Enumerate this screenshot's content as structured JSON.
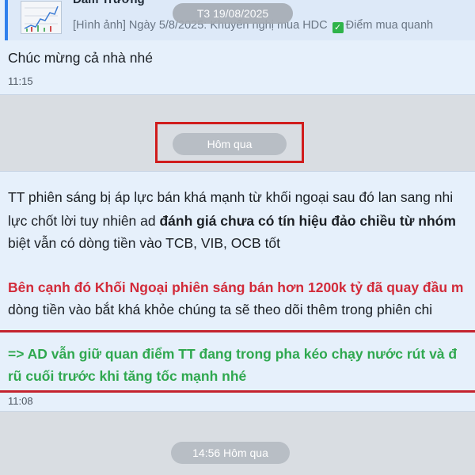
{
  "top_message": {
    "reply_author": "Đam Trường",
    "reply_text_prefix": "[Hình ảnh] Ngày 5/8/2025: Khuyến nghị mua HDC",
    "reply_text_suffix": "Điểm mua quanh",
    "text": "Chúc mừng cả nhà nhé",
    "time": "11:15"
  },
  "date_pill": "T3 19/08/2025",
  "day_separator": "Hôm qua",
  "main_message": {
    "line1": "TT phiên sáng bị áp lực bán khá mạnh từ khối ngoại sau đó lan sang nhi",
    "line2_normal": "lực chốt lời tuy nhiên ad ",
    "line2_bold": "đánh giá chưa có tín hiệu đảo chiều từ nhóm",
    "line3": "biệt vẫn có dòng tiền vào TCB, VIB, OCB tốt",
    "line4_red": "Bên cạnh đó Khối Ngoại phiên sáng bán hơn 1200k tỷ đã quay đầu m",
    "line5": "dòng tiền vào bắt khá khỏe chúng ta sẽ theo dõi thêm trong phiên chi",
    "line6_green": "=> AD vẫn giữ quan điểm TT đang trong pha kéo chạy nước rút và đ",
    "line7_green": "rũ cuối trước khi tăng tốc mạnh nhé",
    "time": "11:08"
  },
  "bottom_pill": "14:56 Hôm qua",
  "colors": {
    "red_highlight": "#d22b3a",
    "green_highlight": "#2fa84f",
    "frame_red": "#d01c1c",
    "bubble": "#e6f0fb"
  }
}
